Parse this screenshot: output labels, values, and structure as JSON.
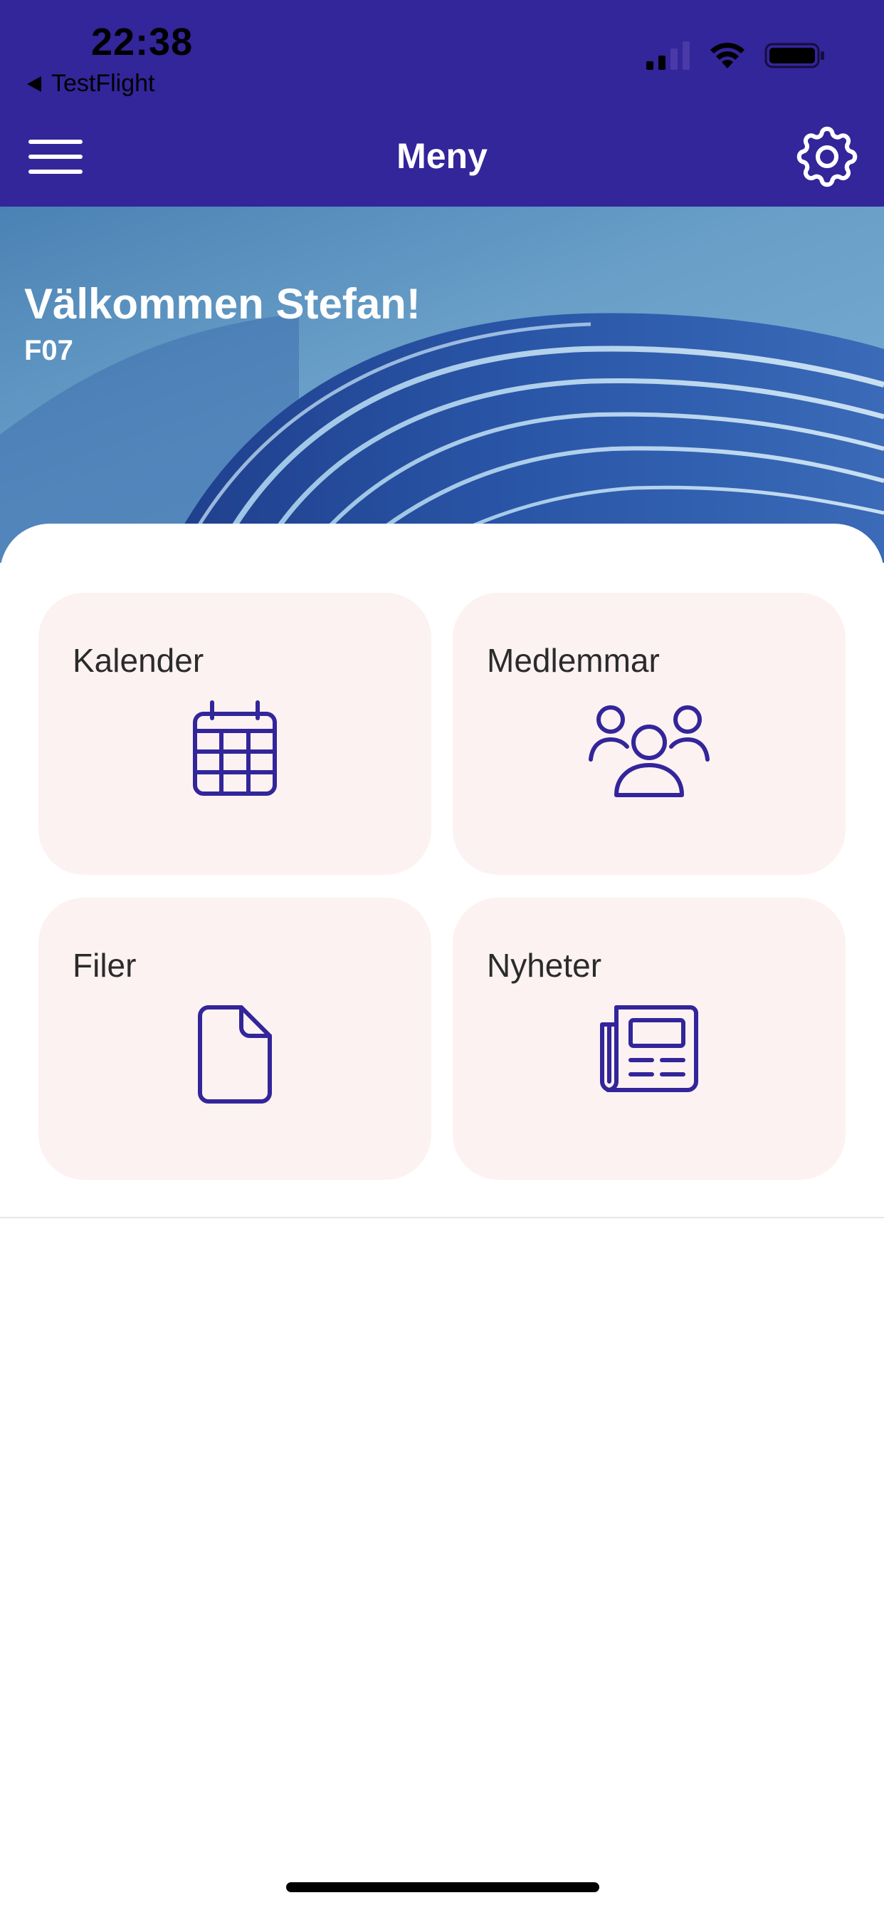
{
  "status_bar": {
    "time": "22:38",
    "back_app": "TestFlight"
  },
  "nav": {
    "title": "Meny",
    "menu_icon": "hamburger-menu-icon",
    "settings_icon": "gear-icon"
  },
  "hero": {
    "welcome": "Välkommen Stefan!",
    "subtitle": "F07"
  },
  "tiles": [
    {
      "label": "Kalender",
      "icon": "calendar-icon"
    },
    {
      "label": "Medlemmar",
      "icon": "members-icon"
    },
    {
      "label": "Filer",
      "icon": "file-icon"
    },
    {
      "label": "Nyheter",
      "icon": "newspaper-icon"
    }
  ],
  "colors": {
    "primary": "#33259a",
    "tile_bg": "#fcf2f2",
    "icon": "#33259a"
  }
}
